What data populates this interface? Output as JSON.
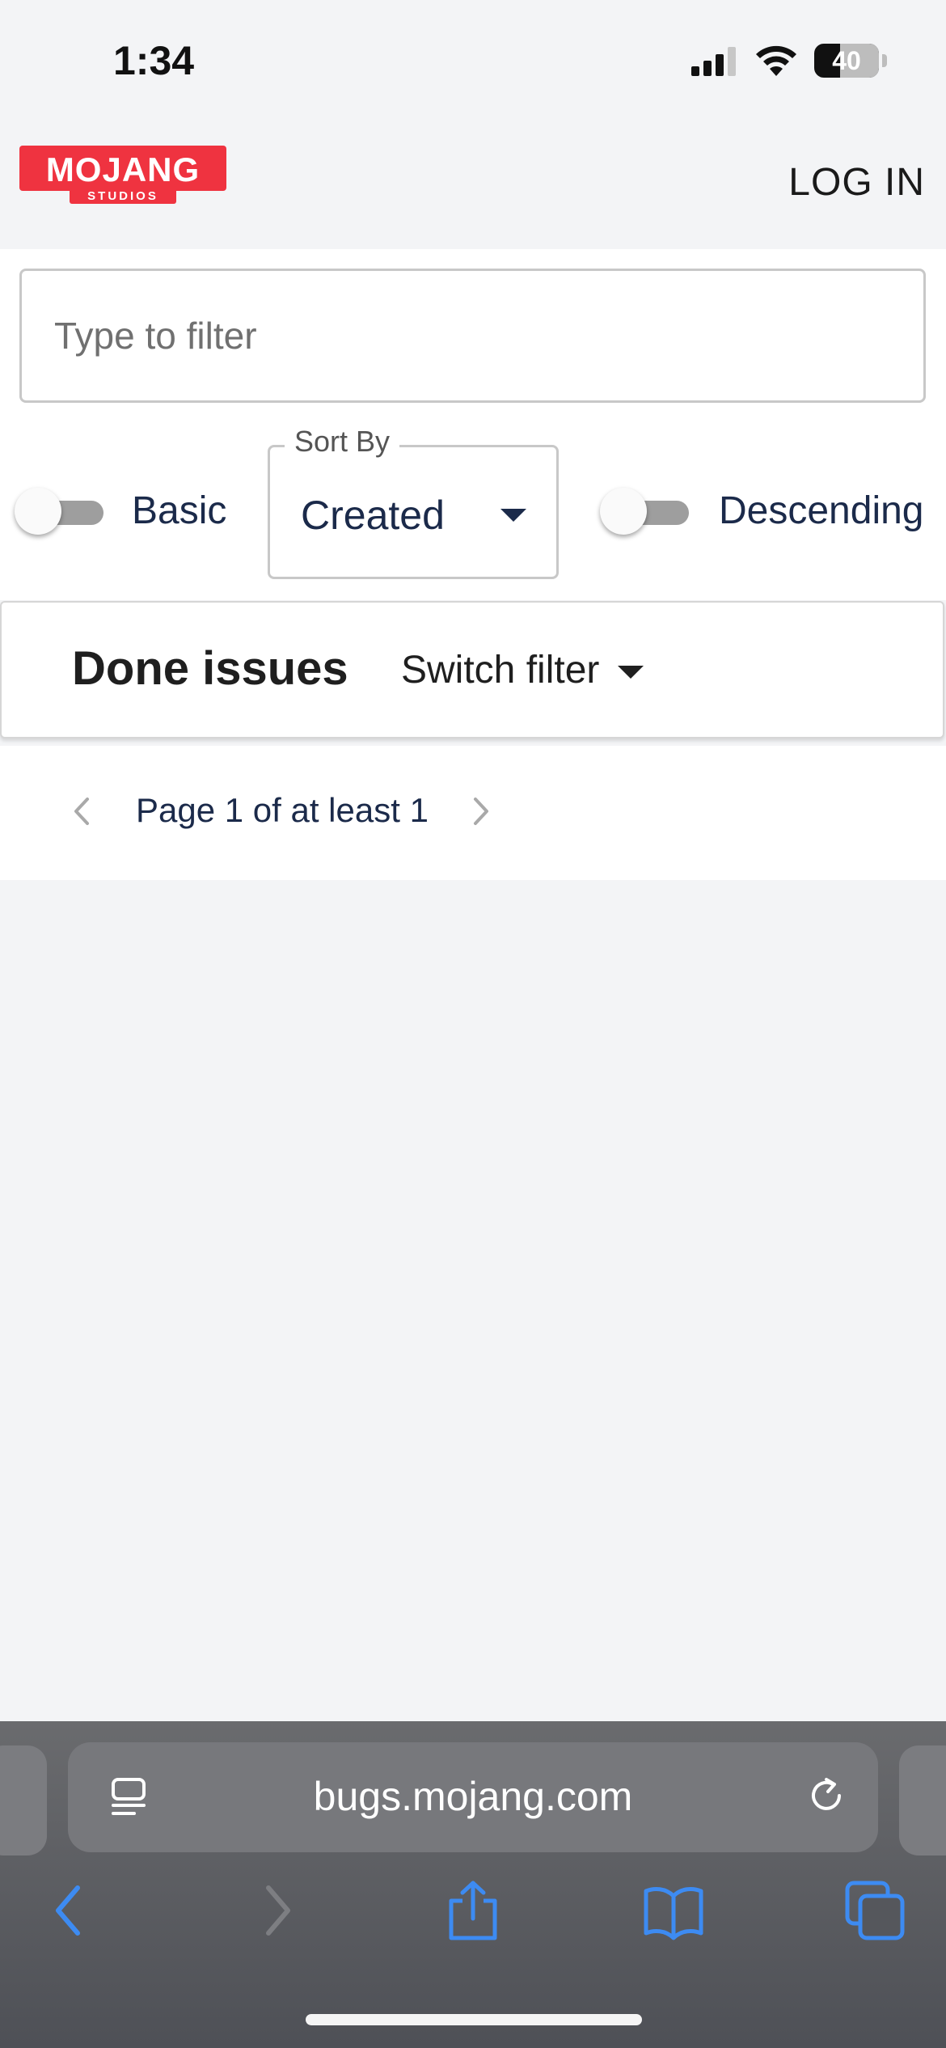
{
  "status_bar": {
    "time": "1:34",
    "battery": "40"
  },
  "header": {
    "logo_label": "MOJANG STUDIOS",
    "login_label": "LOG IN"
  },
  "filters": {
    "search_placeholder": "Type to filter",
    "basic_label": "Basic",
    "basic_on": false,
    "sort_legend": "Sort By",
    "sort_value": "Created",
    "descending_label": "Descending",
    "descending_on": false
  },
  "issues": {
    "title": "Done issues",
    "switch_filter_label": "Switch filter"
  },
  "pagination": {
    "text": "Page 1 of at least 1"
  },
  "browser": {
    "url": "bugs.mojang.com"
  },
  "colors": {
    "brand_red": "#ef3340",
    "text_navy": "#1b2a4a",
    "safari_blue": "#3d8bf2",
    "page_bg": "#f3f4f6"
  }
}
